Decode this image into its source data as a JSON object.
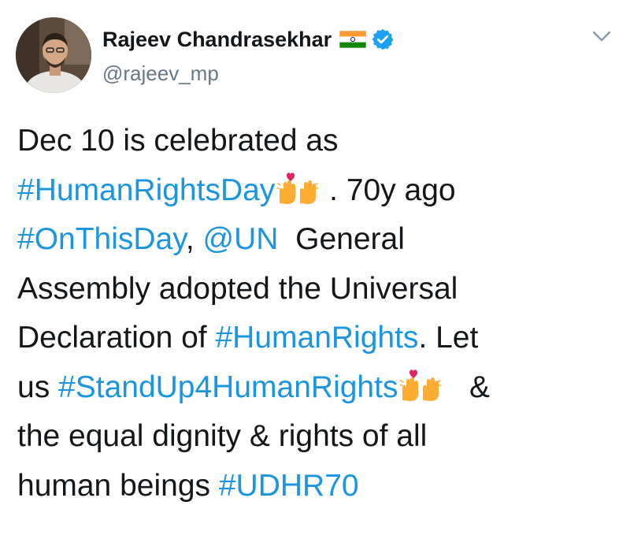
{
  "tweet": {
    "author": {
      "display_name": "Rajeev Chandrasekhar",
      "handle": "@rajeev_mp",
      "flag_icon": "india-flag-icon",
      "verified_icon": "verified-badge-icon"
    },
    "menu_icon": "chevron-down-icon",
    "lines": [
      {
        "t1": "Dec 10 is celebrated as"
      },
      {
        "h1": "#HumanRightsDay",
        "t2": " . 70y ago"
      },
      {
        "h1": "#OnThisDay",
        "t2": ", ",
        "h2": "@UN",
        "t3": "  General"
      },
      {
        "t1": "Assembly adopted the Universal"
      },
      {
        "t1": "Declaration of ",
        "h1": "#HumanRights",
        "t2": ". Let"
      },
      {
        "t1": "us ",
        "h1": "#StandUp4HumanRights",
        "t2": "   &"
      },
      {
        "t1": "the equal dignity & rights of all"
      },
      {
        "t1": "human beings ",
        "h1": "#UDHR70"
      }
    ],
    "emoji": "raising-hands-heart-emoji",
    "colors": {
      "link": "#1b95e0",
      "text": "#14171a",
      "secondary": "#657786",
      "verified": "#1da1f2"
    }
  }
}
